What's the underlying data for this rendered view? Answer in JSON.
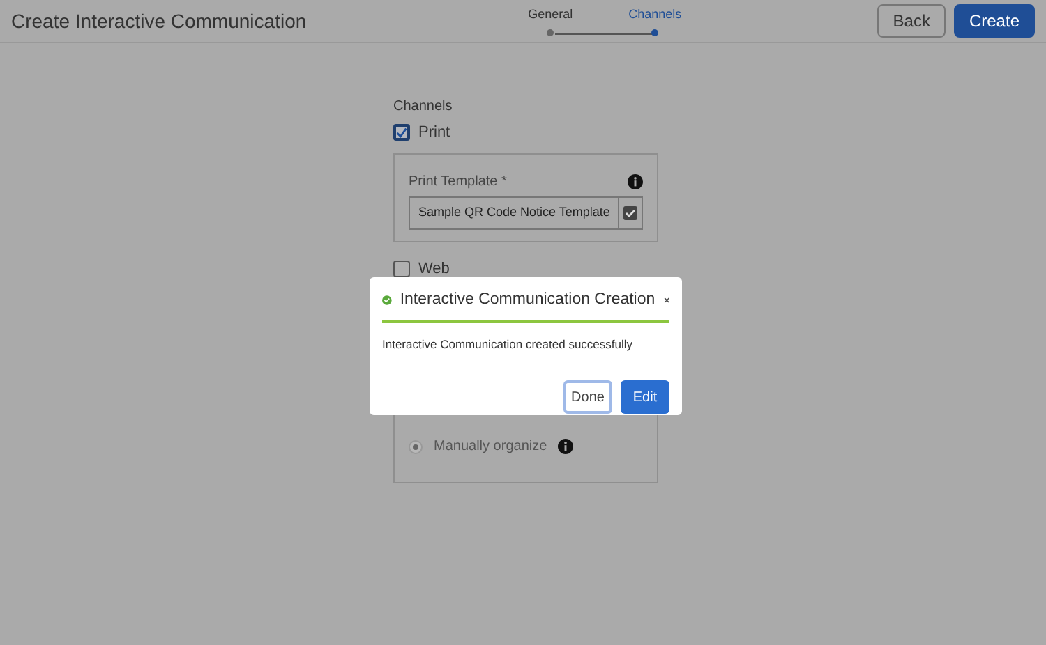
{
  "header": {
    "title": "Create Interactive Communication",
    "steps": [
      {
        "label": "General",
        "selected": false
      },
      {
        "label": "Channels",
        "selected": true
      }
    ],
    "buttons": [
      {
        "label": "Back",
        "kind": "secondary"
      },
      {
        "label": "Create",
        "kind": "primary"
      }
    ]
  },
  "form": {
    "section_label": "Channels",
    "channels": [
      {
        "label": "Print",
        "checked": true,
        "template": {
          "label": "Print Template *",
          "value": "Sample QR Code Notice Template"
        }
      },
      {
        "label": "Web",
        "checked": false,
        "layouts": [
          {
            "label": "Manually organize",
            "selected": true,
            "disabled": true
          }
        ]
      }
    ]
  },
  "dialog": {
    "title": "Interactive Communication Creation",
    "message": "Interactive Communication created successfully",
    "buttons": [
      {
        "label": "Done",
        "kind": "secondary"
      },
      {
        "label": "Edit",
        "kind": "primary"
      }
    ]
  }
}
